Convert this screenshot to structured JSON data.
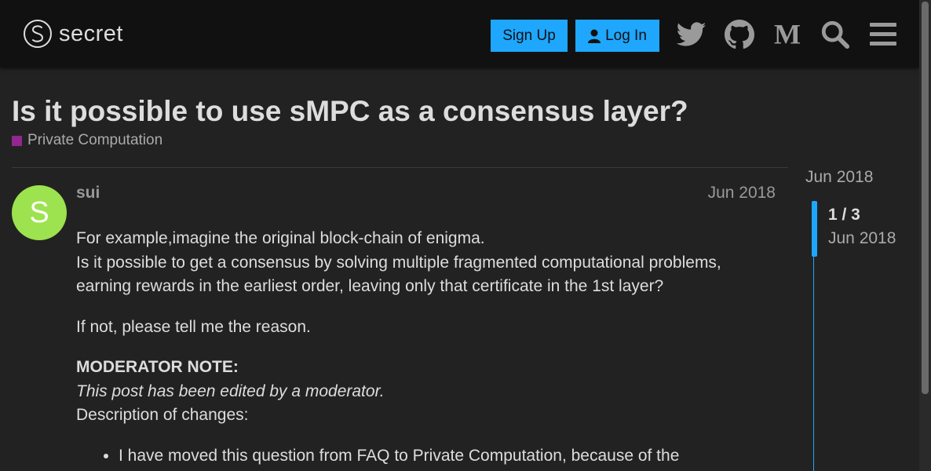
{
  "header": {
    "logo_text": "secret",
    "signup_label": "Sign Up",
    "login_label": "Log In",
    "icons": [
      "twitter-icon",
      "github-icon",
      "medium-icon",
      "search-icon",
      "hamburger-menu-icon"
    ],
    "accent_color": "#1ea7fd"
  },
  "topic": {
    "title": "Is it possible to use sMPC as a consensus layer?",
    "category": "Private Computation",
    "category_color": "#92278f"
  },
  "post": {
    "avatar_letter": "S",
    "avatar_color": "#9de24f",
    "username": "sui",
    "date": "Jun 2018",
    "line1": "For example,imagine the original block-chain of enigma.",
    "line2": "Is it possible to get a consensus by solving multiple fragmented computational problems, earning rewards in the earliest order, leaving only that certificate in the 1st layer?",
    "para2": "If not, please tell me the reason.",
    "mod_heading": "MODERATOR NOTE:",
    "mod_italic": "This post has been edited by a moderator.",
    "mod_desc": "Description of changes:",
    "bullet1": "I have moved this question from FAQ to Private Computation, because of the"
  },
  "timeline": {
    "start_date": "Jun 2018",
    "counter": "1 / 3",
    "current_date": "Jun 2018"
  }
}
